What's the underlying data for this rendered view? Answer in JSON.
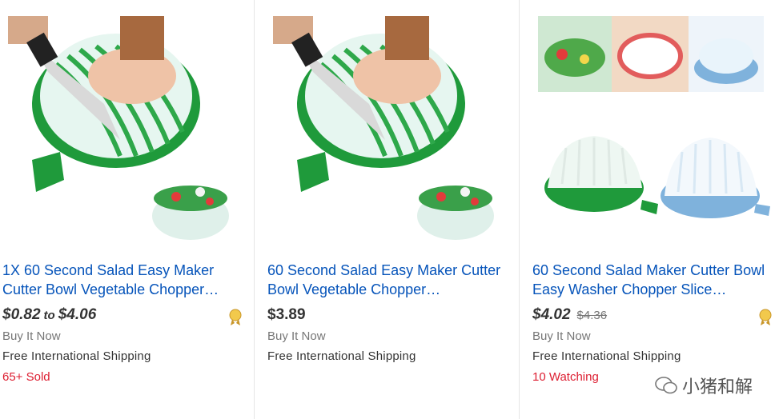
{
  "items": [
    {
      "title": "1X 60 Second Salad Easy Maker Cutter Bowl Vegetable Chopper…",
      "price_from": "$0.82",
      "price_to_word": "to",
      "price_to": "$4.06",
      "format": "Buy It Now",
      "shipping": "Free International Shipping",
      "hotness": "65+ Sold"
    },
    {
      "title": "60 Second Salad Easy Maker Cutter Bowl Vegetable Chopper…",
      "price": "$3.89",
      "format": "Buy It Now",
      "shipping": "Free International Shipping"
    },
    {
      "title": "60 Second Salad Maker Cutter Bowl Easy Washer Chopper Slice…",
      "price": "$4.02",
      "was_price": "$4.36",
      "format": "Buy It Now",
      "shipping": "Free International Shipping",
      "hotness": "10 Watching"
    }
  ],
  "watermark": {
    "text": "小猪和解"
  },
  "colors": {
    "link": "#0654ba",
    "hot": "#dd1e31",
    "bowl_green": "#1f9a3b",
    "bowl_blue": "#7fb2dc"
  }
}
